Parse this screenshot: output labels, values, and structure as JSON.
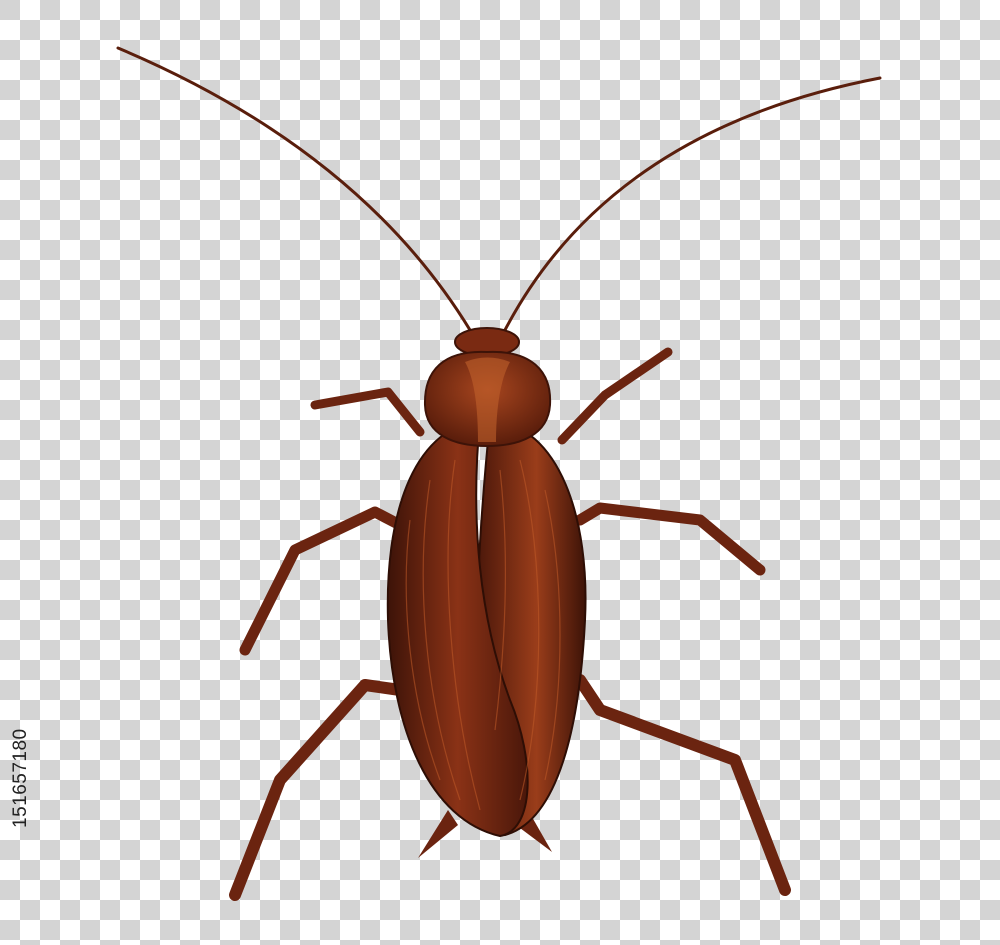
{
  "image": {
    "subject": "cockroach-illustration",
    "background": "transparency-checkerboard",
    "stock_id": "151657180",
    "colors": {
      "checker_light": "#ffffff",
      "checker_dark": "#d4d4d4",
      "body_dark": "#3d1308",
      "body_mid": "#7a2a12",
      "body_light": "#a8461f",
      "leg": "#6b2410",
      "antenna": "#5a1e0c"
    }
  }
}
